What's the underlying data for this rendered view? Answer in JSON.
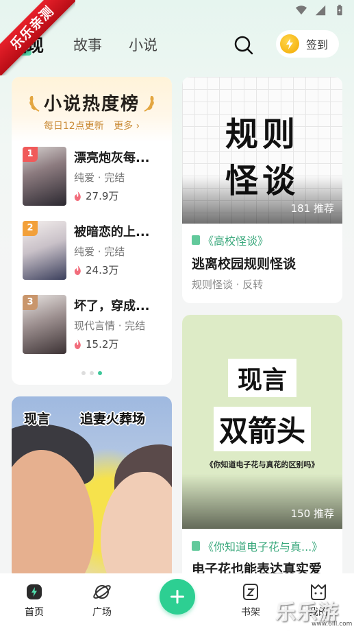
{
  "watermark": {
    "ribbon": "乐乐亲测",
    "corner": "乐乐游戏",
    "url": "www.6ill.com"
  },
  "header": {
    "tabs": [
      {
        "label": "发现",
        "active": true
      },
      {
        "label": "故事",
        "active": false
      },
      {
        "label": "小说",
        "active": false
      }
    ],
    "search_icon": "search-icon",
    "signin_label": "签到",
    "accent": "#51d4a8"
  },
  "ranking": {
    "title": "小说热度榜",
    "update_note": "每日12点更新",
    "more_label": "更多",
    "items": [
      {
        "rank": "1",
        "title": "漂亮炮灰每...",
        "meta": "纯爱 · 完结",
        "heat": "27.9万"
      },
      {
        "rank": "2",
        "title": "被暗恋的上...",
        "meta": "纯爱 · 完结",
        "heat": "24.3万"
      },
      {
        "rank": "3",
        "title": "坏了，穿成...",
        "meta": "现代言情 · 完结",
        "heat": "15.2万"
      }
    ],
    "page_dots": 3,
    "active_dot": 3
  },
  "books": [
    {
      "cover_lines": [
        "规则",
        "怪谈"
      ],
      "recommend": "181 推荐",
      "tag": "《高校怪谈》",
      "title": "逃离校园规则怪谈",
      "meta": "规则怪谈 · 反转"
    },
    {
      "cover_lines": [
        "现言",
        "双箭头"
      ],
      "cover_sub": "《你知道电子花与真花的区别吗》",
      "recommend": "150 推荐",
      "tag": "《你知道电子花与真...》",
      "title": "电子花也能表达真实爱"
    },
    {
      "cover_left": "现言",
      "cover_right": "追妻火葬场"
    }
  ],
  "bottom_nav": {
    "items": [
      {
        "label": "首页",
        "icon": "home-icon"
      },
      {
        "label": "广场",
        "icon": "planet-icon"
      },
      {
        "label": "书架",
        "icon": "bookshelf-icon"
      },
      {
        "label": "我的",
        "icon": "profile-icon"
      }
    ],
    "fab_icon": "plus-icon",
    "fab_color": "#2dcf92"
  }
}
